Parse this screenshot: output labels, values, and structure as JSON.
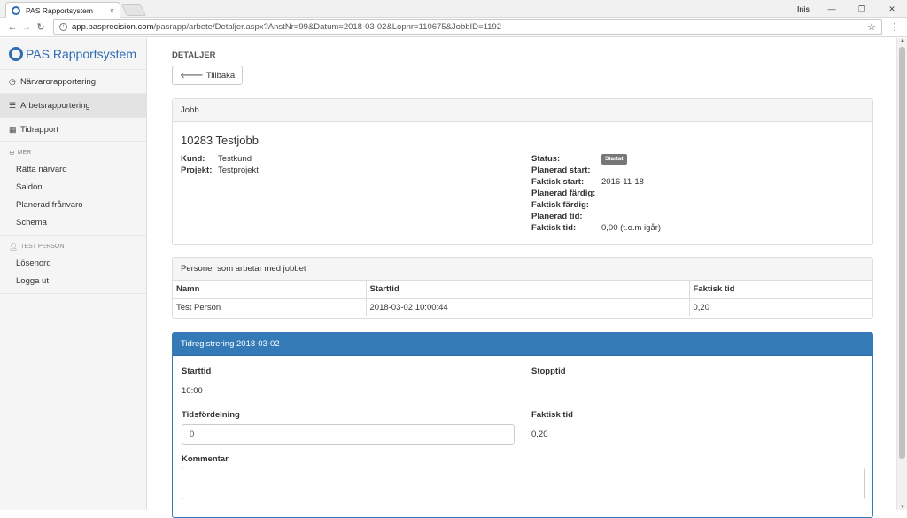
{
  "browser": {
    "tab_title": "PAS Rapportsystem",
    "tab_close": "×",
    "profile": "Inis",
    "url_host": "app.pasprecision.com",
    "url_path": "/pasrapp/arbete/Detaljer.aspx?AnstNr=99&Datum=2018-03-02&Lopnr=110675&JobbID=1192"
  },
  "sidebar": {
    "brand": "PAS Rapportsystem",
    "items": [
      {
        "label": "Närvarorapportering",
        "icon": "clock-icon"
      },
      {
        "label": "Arbetsrapportering",
        "icon": "list-icon"
      },
      {
        "label": "Tidrapport",
        "icon": "calendar-icon"
      }
    ],
    "mer_heading": "MER",
    "mer_items": [
      "Rätta närvaro",
      "Saldon",
      "Planerad frånvaro",
      "Schema"
    ],
    "user_heading": "TEST PERSON",
    "user_items": [
      "Lösenord",
      "Logga ut"
    ]
  },
  "main": {
    "heading": "DETALJER",
    "back_label": "Tillbaka",
    "job_panel": {
      "header": "Jobb",
      "title": "10283 Testjobb",
      "kund_label": "Kund:",
      "kund_value": "Testkund",
      "projekt_label": "Projekt:",
      "projekt_value": "Testprojekt",
      "status_label": "Status:",
      "status_badge": "Startat",
      "planerad_start_label": "Planerad start:",
      "faktisk_start_label": "Faktisk start:",
      "faktisk_start_value": "2016-11-18",
      "planerad_fardig_label": "Planerad färdig:",
      "faktisk_fardig_label": "Faktisk färdig:",
      "planerad_tid_label": "Planerad tid:",
      "faktisk_tid_label": "Faktisk tid:",
      "faktisk_tid_value": "0,00 (t.o.m igår)"
    },
    "persons_panel": {
      "header": "Personer som arbetar med jobbet",
      "columns": [
        "Namn",
        "Starttid",
        "Faktisk tid"
      ],
      "rows": [
        [
          "Test Person",
          "2018-03-02 10:00:44",
          "0,20"
        ]
      ]
    },
    "time_panel": {
      "header": "Tidregistrering 2018-03-02",
      "starttid_label": "Starttid",
      "starttid_value": "10:00",
      "stopptid_label": "Stopptid",
      "tidsfordelning_label": "Tidsfördelning",
      "tidsfordelning_value": "0",
      "faktisk_tid_label": "Faktisk tid",
      "faktisk_tid_value": "0,20",
      "kommentar_label": "Kommentar",
      "kommentar_value": ""
    }
  },
  "colors": {
    "brand": "#2d6db5",
    "primary": "#337ab7",
    "badge": "#777777"
  }
}
